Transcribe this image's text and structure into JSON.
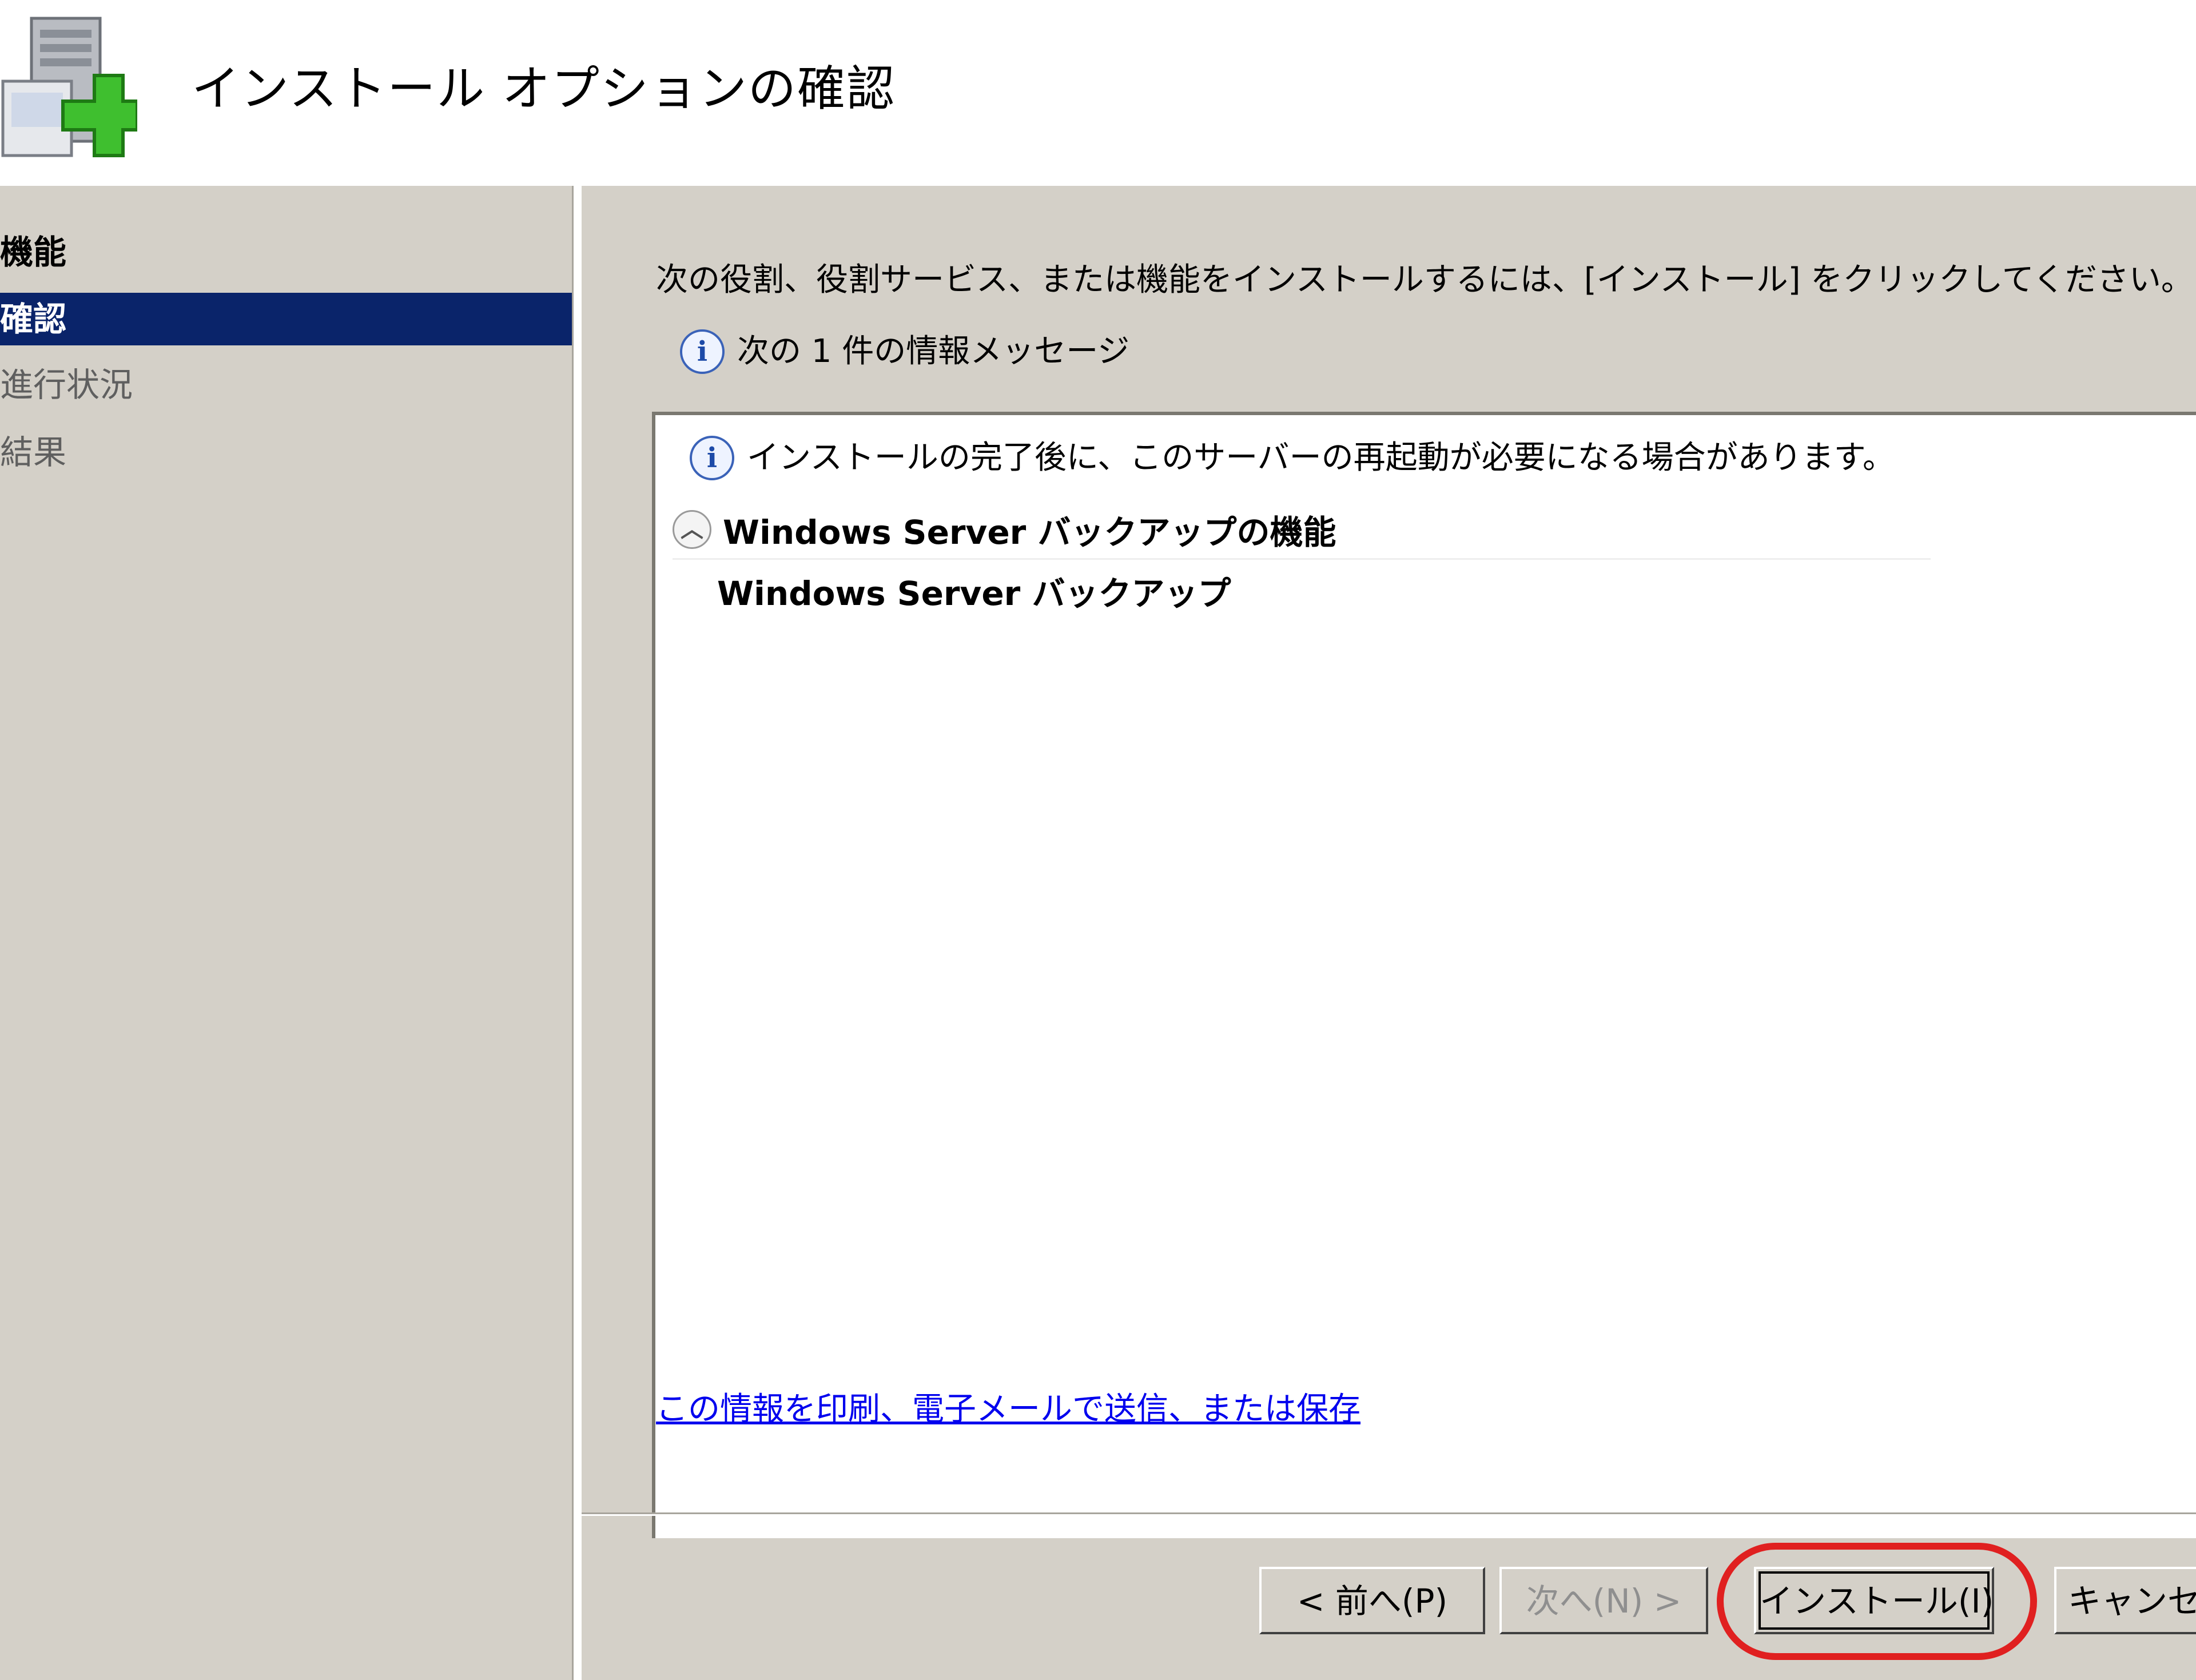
{
  "header": {
    "title": "インストール オプションの確認",
    "icon": "server-add-icon"
  },
  "sidebar": {
    "items": [
      {
        "label": "機能",
        "state": "done"
      },
      {
        "label": "確認",
        "state": "active"
      },
      {
        "label": "進行状況",
        "state": "pending"
      },
      {
        "label": "結果",
        "state": "pending"
      }
    ]
  },
  "main": {
    "intro": "次の役割、役割サービス、または機能をインストールするには、[インストール] をクリックしてください。",
    "info_summary": "次の 1 件の情報メッセージ",
    "details": {
      "message": "インストールの完了後に、このサーバーの再起動が必要になる場合があります。",
      "section_title": "Windows Server バックアップの機能",
      "section_item": "Windows Server バックアップ"
    },
    "print_link": "この情報を印刷、電子メールで送信、または保存"
  },
  "buttons": {
    "back": "< 前へ(P)",
    "next": "次へ(N) >",
    "install": "インストール(I)",
    "cancel": "キャンセル"
  },
  "colors": {
    "active_item_bg": "#0a246a",
    "link": "#0000ee",
    "highlight": "#e02020",
    "dialog_bg": "#d4d0c8"
  }
}
